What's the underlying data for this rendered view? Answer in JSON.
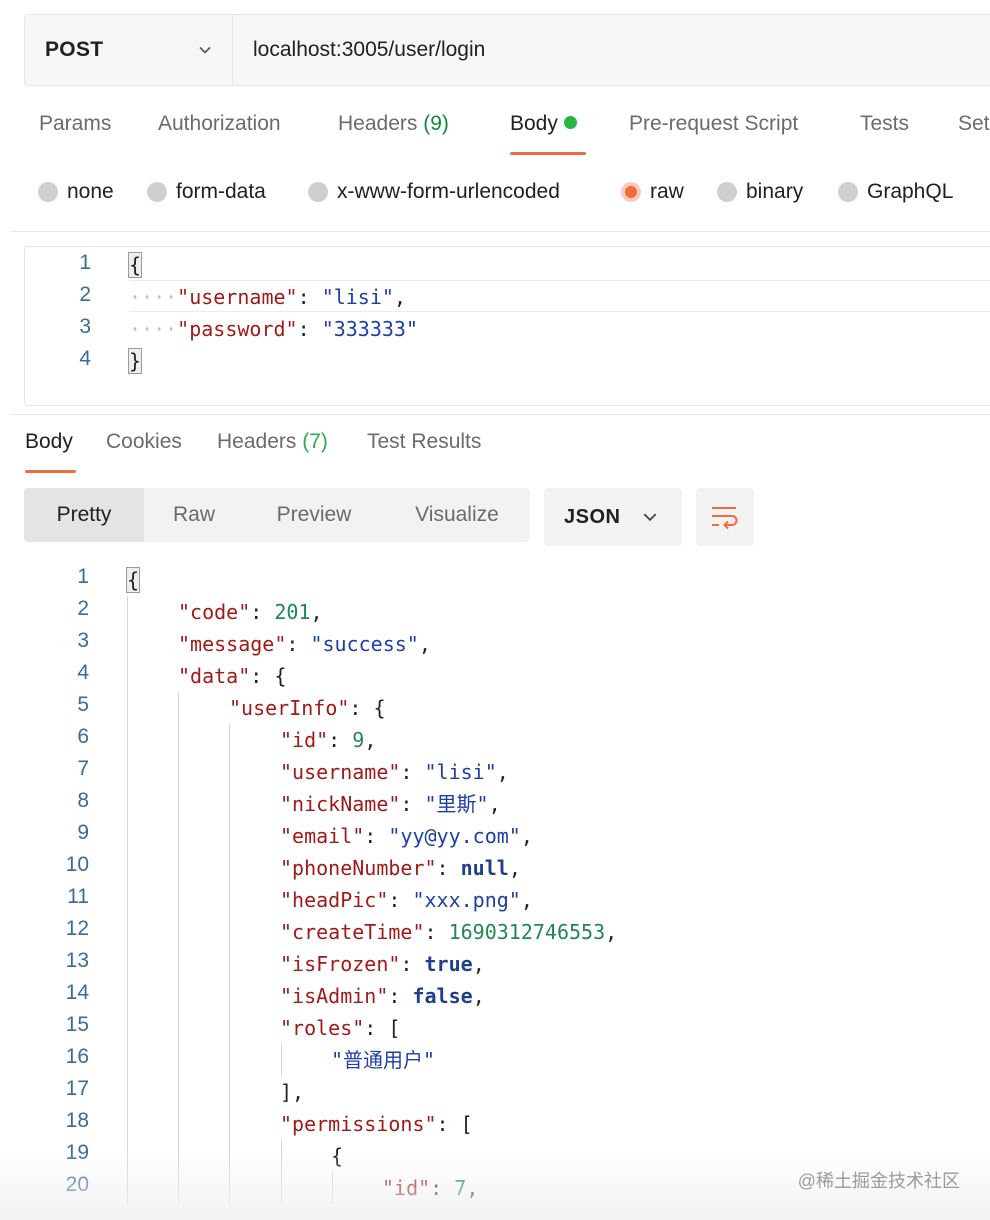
{
  "request": {
    "method": "POST",
    "url": "localhost:3005/user/login"
  },
  "request_tabs": [
    {
      "label": "Params"
    },
    {
      "label": "Authorization"
    },
    {
      "label": "Headers",
      "count": "(9)"
    },
    {
      "label": "Body"
    },
    {
      "label": "Pre-request Script"
    },
    {
      "label": "Tests"
    },
    {
      "label": "Set"
    }
  ],
  "body_types": [
    "none",
    "form-data",
    "x-www-form-urlencoded",
    "raw",
    "binary",
    "GraphQL"
  ],
  "selected_body_type": "raw",
  "request_body": {
    "line_numbers": [
      "1",
      "2",
      "3",
      "4"
    ],
    "username_key": "\"username\"",
    "username_value": "\"lisi\"",
    "password_key": "\"password\"",
    "password_value": "\"333333\""
  },
  "response_tabs": [
    {
      "label": "Body"
    },
    {
      "label": "Cookies"
    },
    {
      "label": "Headers",
      "count": "(7)"
    },
    {
      "label": "Test Results"
    }
  ],
  "view_modes": [
    "Pretty",
    "Raw",
    "Preview",
    "Visualize"
  ],
  "format": "JSON",
  "response_lines": [
    {
      "n": "1",
      "indent": 0,
      "parts": [
        [
          "brace",
          "{"
        ]
      ]
    },
    {
      "n": "2",
      "indent": 1,
      "parts": [
        [
          "key",
          "\"code\""
        ],
        [
          "punc",
          ": "
        ],
        [
          "num",
          "201"
        ],
        [
          "punc",
          ","
        ]
      ]
    },
    {
      "n": "3",
      "indent": 1,
      "parts": [
        [
          "key",
          "\"message\""
        ],
        [
          "punc",
          ": "
        ],
        [
          "str",
          "\"success\""
        ],
        [
          "punc",
          ","
        ]
      ]
    },
    {
      "n": "4",
      "indent": 1,
      "parts": [
        [
          "key",
          "\"data\""
        ],
        [
          "punc",
          ": {"
        ]
      ]
    },
    {
      "n": "5",
      "indent": 2,
      "parts": [
        [
          "key",
          "\"userInfo\""
        ],
        [
          "punc",
          ": {"
        ]
      ]
    },
    {
      "n": "6",
      "indent": 3,
      "parts": [
        [
          "key",
          "\"id\""
        ],
        [
          "punc",
          ": "
        ],
        [
          "num",
          "9"
        ],
        [
          "punc",
          ","
        ]
      ]
    },
    {
      "n": "7",
      "indent": 3,
      "parts": [
        [
          "key",
          "\"username\""
        ],
        [
          "punc",
          ": "
        ],
        [
          "str",
          "\"lisi\""
        ],
        [
          "punc",
          ","
        ]
      ]
    },
    {
      "n": "8",
      "indent": 3,
      "parts": [
        [
          "key",
          "\"nickName\""
        ],
        [
          "punc",
          ": "
        ],
        [
          "str",
          "\"里斯\""
        ],
        [
          "punc",
          ","
        ]
      ]
    },
    {
      "n": "9",
      "indent": 3,
      "parts": [
        [
          "key",
          "\"email\""
        ],
        [
          "punc",
          ": "
        ],
        [
          "str",
          "\"yy@yy.com\""
        ],
        [
          "punc",
          ","
        ]
      ]
    },
    {
      "n": "10",
      "indent": 3,
      "parts": [
        [
          "key",
          "\"phoneNumber\""
        ],
        [
          "punc",
          ": "
        ],
        [
          "kw",
          "null"
        ],
        [
          "punc",
          ","
        ]
      ]
    },
    {
      "n": "11",
      "indent": 3,
      "parts": [
        [
          "key",
          "\"headPic\""
        ],
        [
          "punc",
          ": "
        ],
        [
          "str",
          "\"xxx.png\""
        ],
        [
          "punc",
          ","
        ]
      ]
    },
    {
      "n": "12",
      "indent": 3,
      "parts": [
        [
          "key",
          "\"createTime\""
        ],
        [
          "punc",
          ": "
        ],
        [
          "num",
          "1690312746553"
        ],
        [
          "punc",
          ","
        ]
      ]
    },
    {
      "n": "13",
      "indent": 3,
      "parts": [
        [
          "key",
          "\"isFrozen\""
        ],
        [
          "punc",
          ": "
        ],
        [
          "kw",
          "true"
        ],
        [
          "punc",
          ","
        ]
      ]
    },
    {
      "n": "14",
      "indent": 3,
      "parts": [
        [
          "key",
          "\"isAdmin\""
        ],
        [
          "punc",
          ": "
        ],
        [
          "kw",
          "false"
        ],
        [
          "punc",
          ","
        ]
      ]
    },
    {
      "n": "15",
      "indent": 3,
      "parts": [
        [
          "key",
          "\"roles\""
        ],
        [
          "punc",
          ": ["
        ]
      ]
    },
    {
      "n": "16",
      "indent": 4,
      "parts": [
        [
          "str",
          "\"普通用户\""
        ]
      ]
    },
    {
      "n": "17",
      "indent": 3,
      "parts": [
        [
          "punc",
          "],"
        ]
      ]
    },
    {
      "n": "18",
      "indent": 3,
      "parts": [
        [
          "key",
          "\"permissions\""
        ],
        [
          "punc",
          ": ["
        ]
      ]
    },
    {
      "n": "19",
      "indent": 4,
      "parts": [
        [
          "punc",
          "{"
        ]
      ]
    },
    {
      "n": "20",
      "indent": 5,
      "parts": [
        [
          "key",
          "\"id\""
        ],
        [
          "punc",
          ": "
        ],
        [
          "num",
          "7"
        ],
        [
          "punc",
          ","
        ]
      ]
    }
  ],
  "watermark": "@稀土掘金技术社区"
}
